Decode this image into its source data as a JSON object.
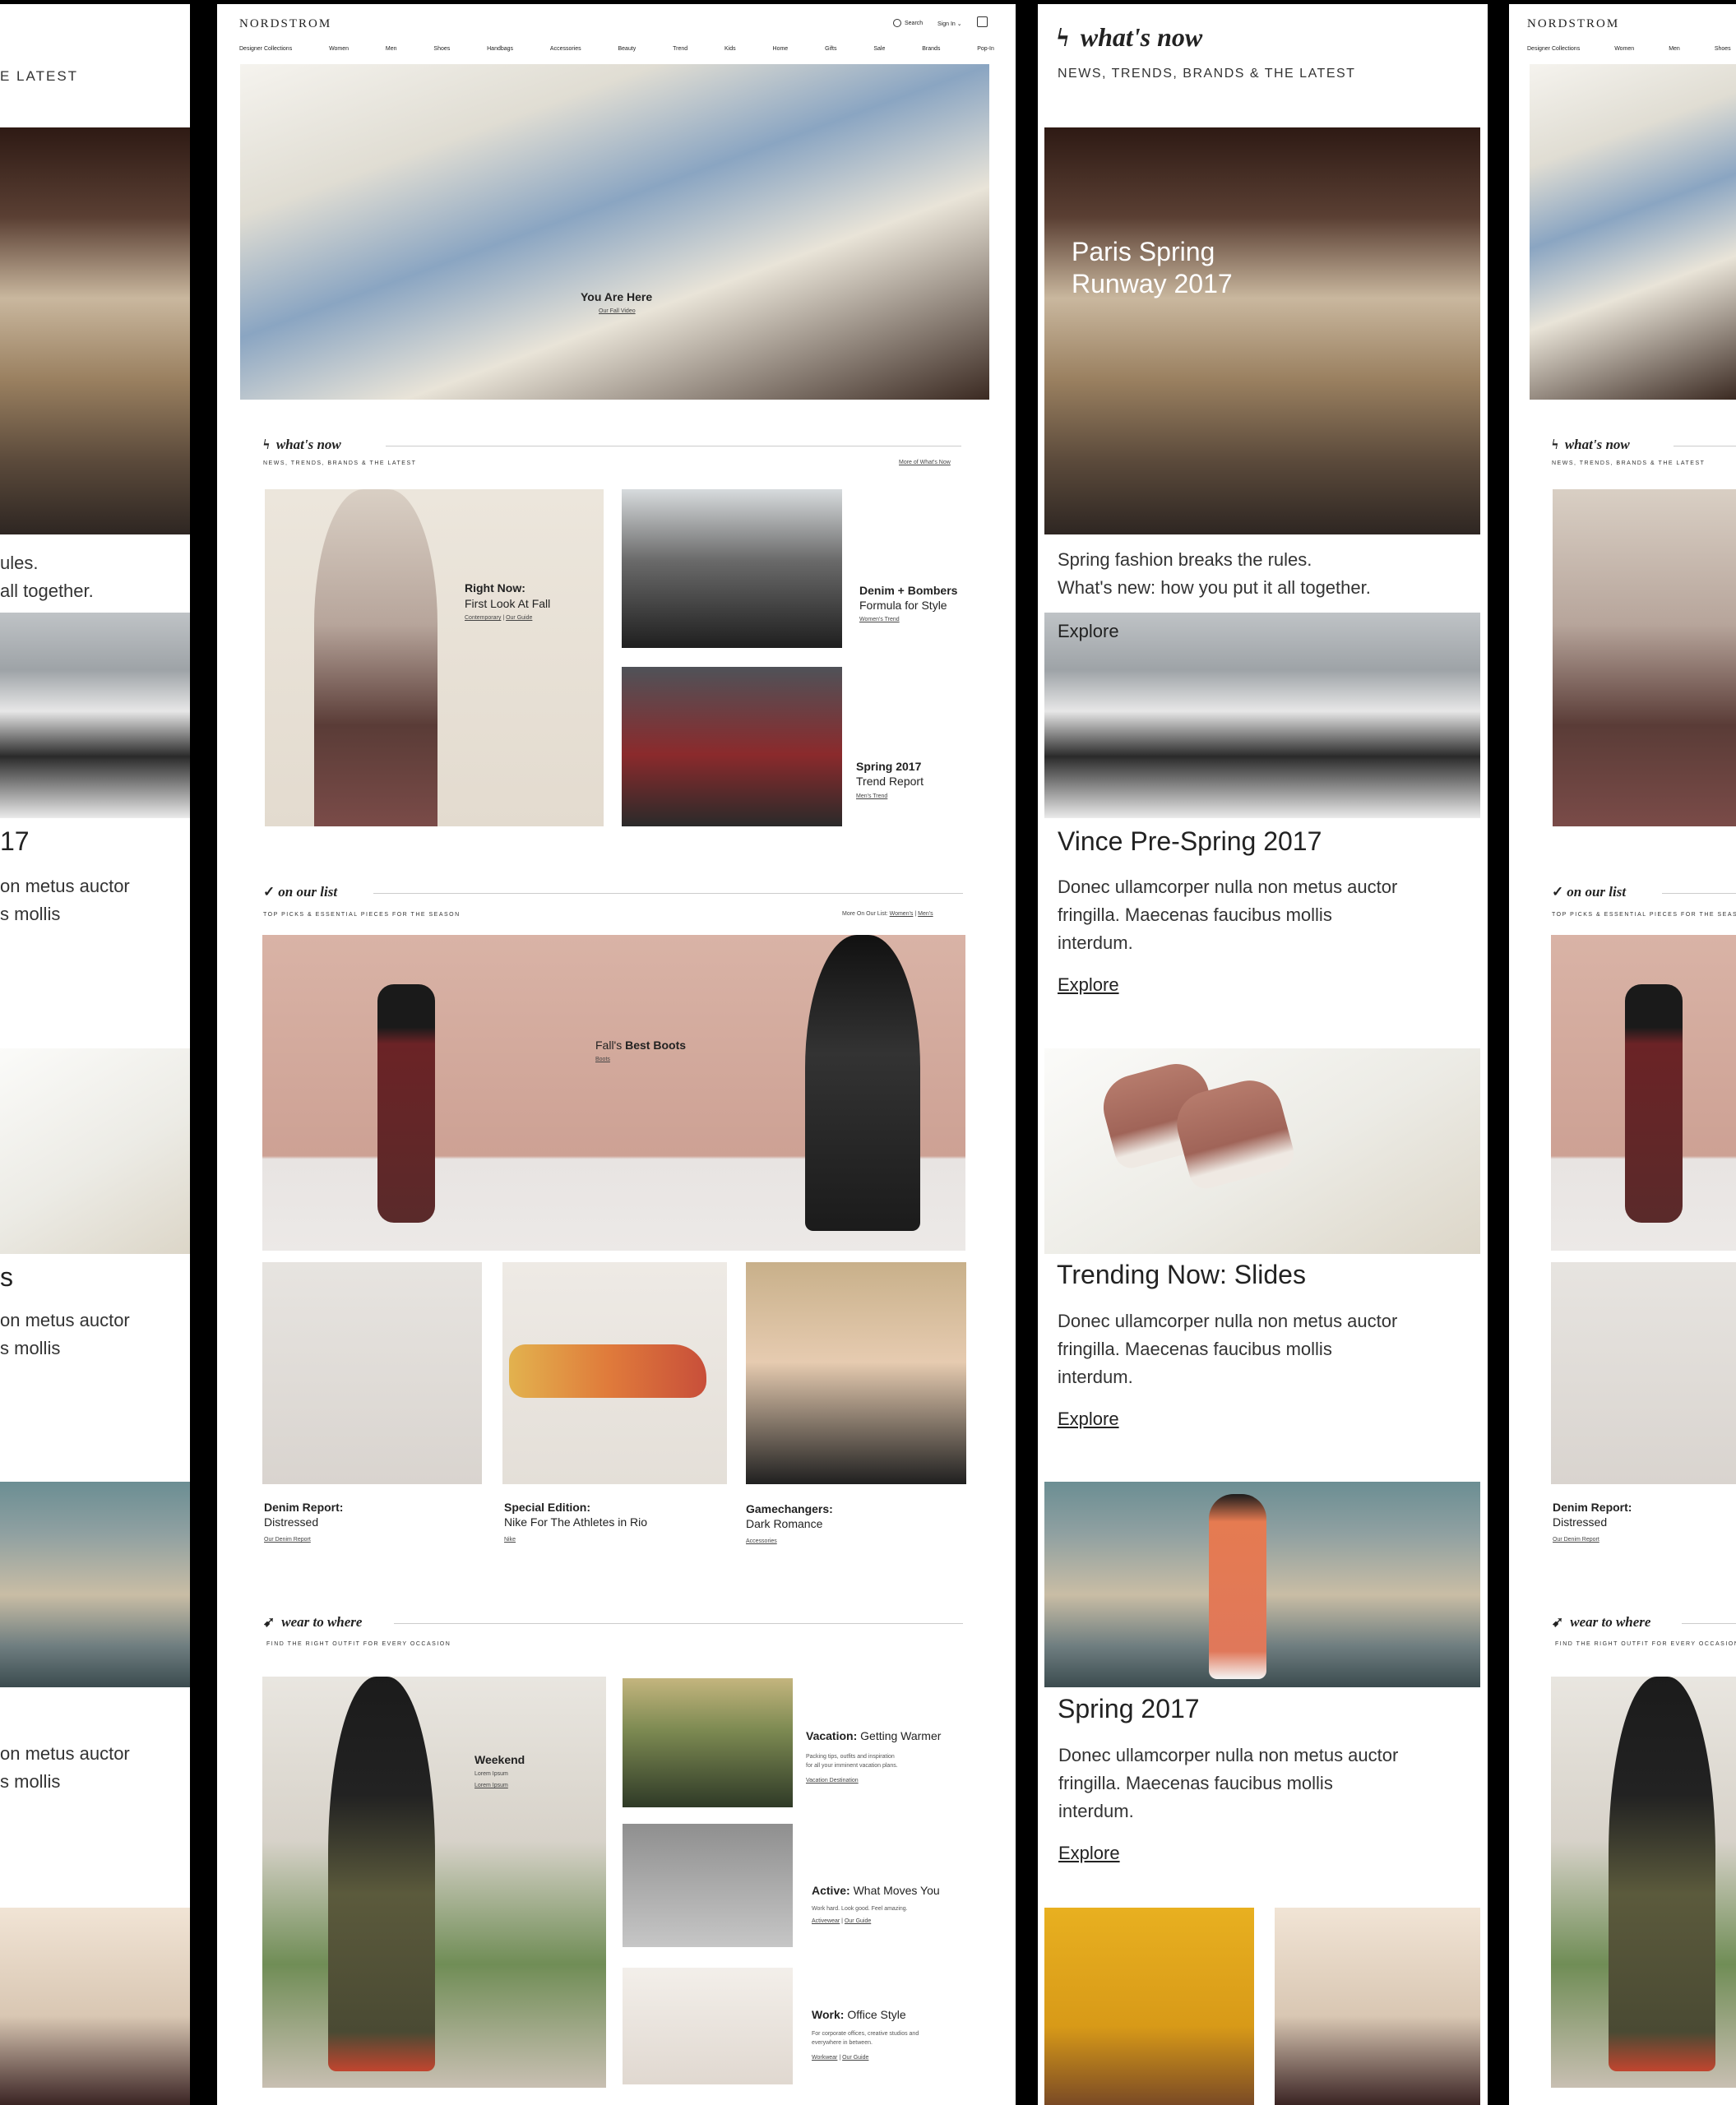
{
  "brand": "NORDSTROM",
  "header": {
    "search_label": "Search",
    "signin_label": "Sign In",
    "nav": [
      "Designer Collections",
      "Women",
      "Men",
      "Shoes",
      "Handbags",
      "Accessories",
      "Beauty",
      "Trend",
      "Kids",
      "Home",
      "Gifts",
      "Sale",
      "Brands",
      "Pop-In"
    ],
    "nav_partial": [
      "Designer Collections",
      "Women",
      "Men",
      "Shoes"
    ]
  },
  "hero": {
    "title": "You Are Here",
    "link": "Our Fall Video"
  },
  "whats_now": {
    "title": "what's now",
    "subtitle": "NEWS, TRENDS, BRANDS & THE LATEST",
    "more_link": "More of What's Now",
    "cards": [
      {
        "title": "Right Now:",
        "subtitle": "First Look At Fall",
        "links": [
          "Contemporary",
          "Our Guide"
        ],
        "sep": "|"
      },
      {
        "title": "Denim + Bombers",
        "subtitle": "Formula for Style",
        "link": "Women's Trend"
      },
      {
        "title": "Spring 2017",
        "subtitle": "Trend Report",
        "link": "Men's Trend"
      }
    ]
  },
  "on_our_list": {
    "title": "on our list",
    "subtitle": "TOP PICKS & ESSENTIAL PIECES FOR THE SEASON",
    "more_prefix": "More On Our List:",
    "more_links": [
      "Women's",
      "Men's"
    ],
    "banner": {
      "title_light": "Fall's",
      "title_bold": "Best Boots",
      "link": "Boots"
    },
    "tiles": [
      {
        "title": "Denim Report:",
        "subtitle": "Distressed",
        "link": "Our Denim Report"
      },
      {
        "title": "Special Edition:",
        "subtitle": "Nike For The Athletes in Rio",
        "link": "Nike"
      },
      {
        "title": "Gamechangers:",
        "subtitle": "Dark Romance",
        "link": "Accessories"
      }
    ]
  },
  "wear_to_where": {
    "title": "wear to where",
    "subtitle": "FIND THE RIGHT OUTFIT FOR EVERY OCCASION",
    "weekend": {
      "title": "Weekend",
      "text": "Lorem Ipsum",
      "link": "Lorem Ipsum"
    },
    "items": [
      {
        "bold": "Vacation:",
        "title": "Getting Warmer",
        "desc1": "Packing tips, outfits and inspiration",
        "desc2": "for all your imminent vacation plans.",
        "link": "Vacation Destination"
      },
      {
        "bold": "Active:",
        "title": "What Moves You",
        "desc1": "Work hard. Look good. Feel amazing.",
        "desc2": "",
        "link1": "Activewear",
        "link2": "Our Guide"
      },
      {
        "bold": "Work:",
        "title": "Office Style",
        "desc1": "For corporate offices, creative studios and",
        "desc2": "everywhere in between.",
        "link1": "Workwear",
        "link2": "Our Guide"
      }
    ]
  },
  "mobile": {
    "title": "what's now",
    "subtitle": "NEWS, TRENDS, BRANDS & THE LATEST",
    "runway_title_1": "Paris Spring",
    "runway_title_2": "Runway 2017",
    "intro_1": "Spring fashion breaks the rules.",
    "intro_2": "What's new: how you put it all together.",
    "intro_explore": "Explore",
    "articles": [
      {
        "title": "Vince Pre-Spring 2017",
        "body_1": "Donec ullamcorper nulla non metus auctor",
        "body_2": "fringilla. Maecenas faucibus mollis",
        "body_3": "interdum.",
        "link": "Explore"
      },
      {
        "title": "Trending Now: Slides",
        "body_1": "Donec ullamcorper nulla non metus auctor",
        "body_2": "fringilla. Maecenas faucibus mollis",
        "body_3": "interdum.",
        "link": "Explore"
      },
      {
        "title": "Spring 2017",
        "body_1": "Donec ullamcorper nulla non metus auctor",
        "body_2": "fringilla. Maecenas faucibus mollis",
        "body_3": "interdum.",
        "link": "Explore"
      }
    ]
  },
  "left_partial": {
    "header": "E LATEST",
    "line_1": "ules.",
    "line_2": "all together.",
    "num": "17",
    "frag_1": "on metus auctor",
    "frag_2": "s mollis",
    "s_letter": "s"
  },
  "colors": {
    "background": "#000000",
    "panel": "#ffffff",
    "text": "#222222"
  }
}
